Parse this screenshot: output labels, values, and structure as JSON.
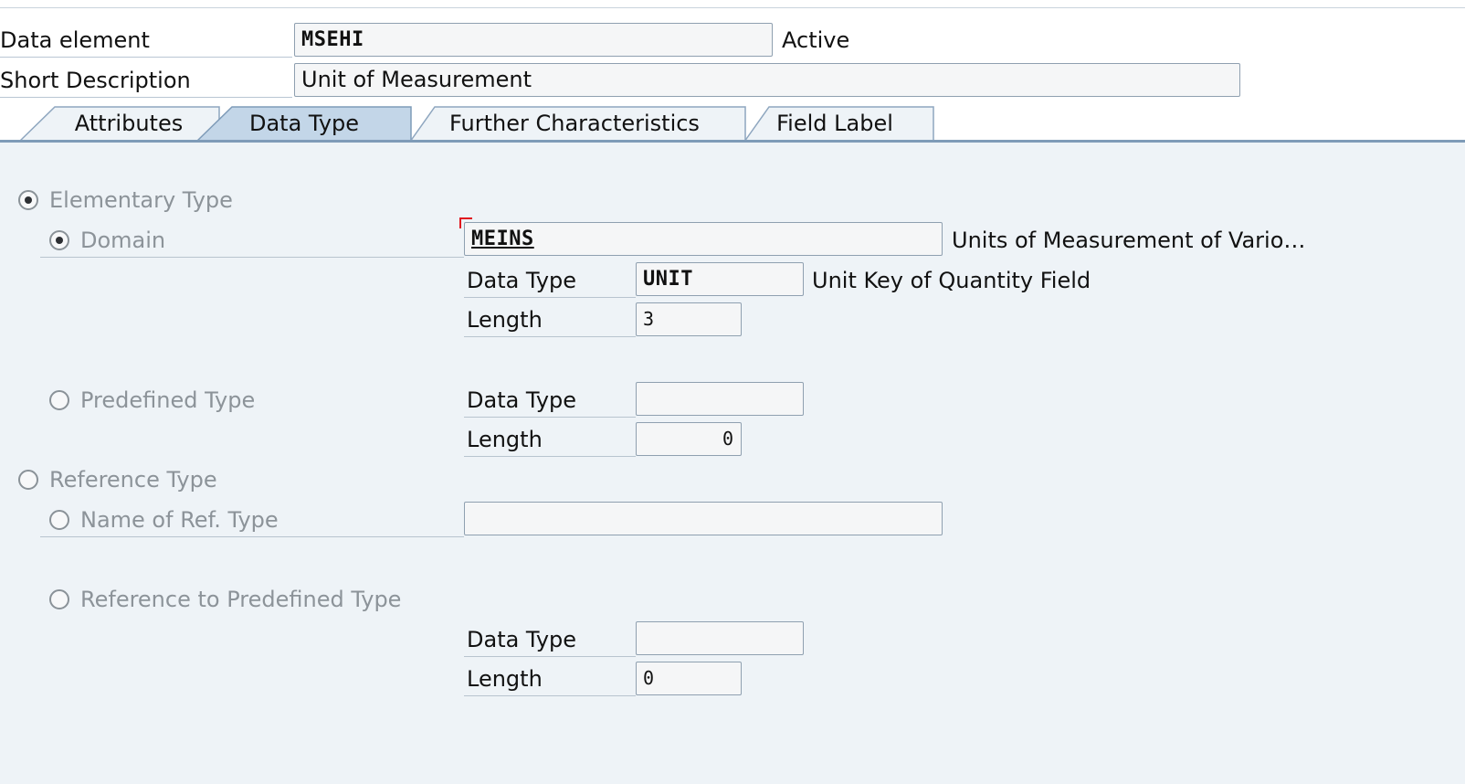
{
  "header": {
    "data_element_label": "Data element",
    "data_element_value": "MSEHI",
    "status": "Active",
    "short_description_label": "Short Description",
    "short_description_value": "Unit of Measurement"
  },
  "tabs": [
    {
      "label": "Attributes",
      "active": false
    },
    {
      "label": "Data Type",
      "active": true
    },
    {
      "label": "Further Characteristics",
      "active": false
    },
    {
      "label": "Field Label",
      "active": false
    }
  ],
  "data_type_tab": {
    "elementary_type": {
      "label": "Elementary Type",
      "selected": true
    },
    "domain": {
      "label": "Domain",
      "selected": true,
      "value": "MEINS",
      "description": "Units of Measurement of Vario…",
      "data_type_label": "Data Type",
      "data_type_value": "UNIT",
      "data_type_description": "Unit Key of Quantity Field",
      "length_label": "Length",
      "length_value": "3"
    },
    "predefined_type": {
      "label": "Predefined Type",
      "selected": false,
      "data_type_label": "Data Type",
      "data_type_value": "",
      "length_label": "Length",
      "length_value": "0"
    },
    "reference_type": {
      "label": "Reference Type",
      "selected": false
    },
    "name_of_ref_type": {
      "label": "Name of Ref. Type",
      "selected": false,
      "value": ""
    },
    "reference_to_predefined_type": {
      "label": "Reference to Predefined Type",
      "selected": false,
      "data_type_label": "Data Type",
      "data_type_value": "",
      "length_label": "Length",
      "length_value": "0"
    }
  },
  "colors": {
    "panel_bg": "#eef3f7",
    "tab_active": "#c6d8e8",
    "tab_border": "#7e9bb8",
    "focus_marker": "#e0141e"
  }
}
